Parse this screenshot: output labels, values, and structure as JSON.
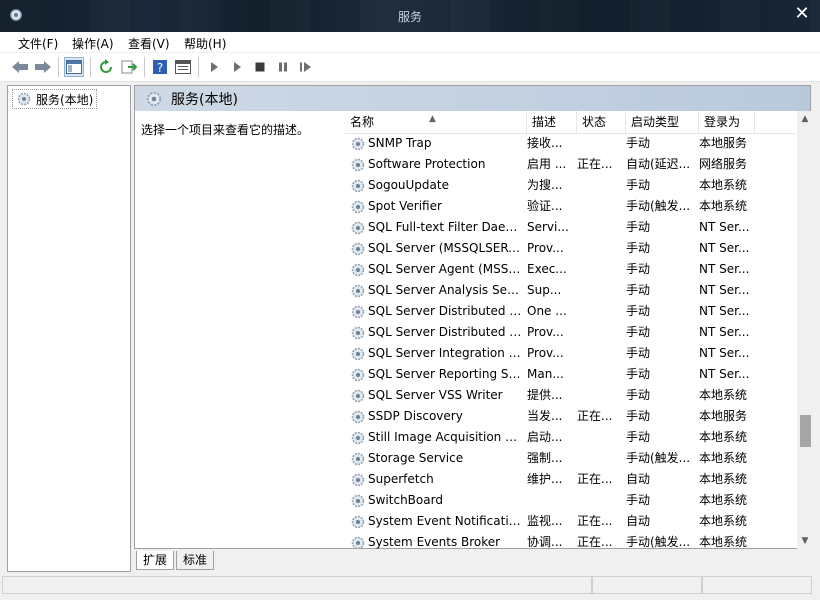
{
  "window": {
    "title": "服务",
    "close": "✕"
  },
  "menu": [
    "文件(F)",
    "操作(A)",
    "查看(V)",
    "帮助(H)"
  ],
  "tree": {
    "root": "服务(本地)"
  },
  "pane": {
    "title": "服务(本地)",
    "description_hint": "选择一个项目来查看它的描述。"
  },
  "columns": [
    "名称",
    "描述",
    "状态",
    "启动类型",
    "登录为"
  ],
  "services": [
    {
      "name": "SNMP Trap",
      "desc": "接收...",
      "status": "",
      "start": "手动",
      "logon": "本地服务"
    },
    {
      "name": "Software Protection",
      "desc": "启用 ...",
      "status": "正在...",
      "start": "自动(延迟...",
      "logon": "网络服务"
    },
    {
      "name": "SogouUpdate",
      "desc": "为搜...",
      "status": "",
      "start": "手动",
      "logon": "本地系统"
    },
    {
      "name": "Spot Verifier",
      "desc": "验证...",
      "status": "",
      "start": "手动(触发...",
      "logon": "本地系统"
    },
    {
      "name": "SQL Full-text Filter Daem...",
      "desc": "Servi...",
      "status": "",
      "start": "手动",
      "logon": "NT Ser..."
    },
    {
      "name": "SQL Server (MSSQLSERV...",
      "desc": "Prov...",
      "status": "",
      "start": "手动",
      "logon": "NT Ser..."
    },
    {
      "name": "SQL Server Agent (MSSQ...",
      "desc": "Exec...",
      "status": "",
      "start": "手动",
      "logon": "NT Ser..."
    },
    {
      "name": "SQL Server Analysis Servi...",
      "desc": "Sup...",
      "status": "",
      "start": "手动",
      "logon": "NT Ser..."
    },
    {
      "name": "SQL Server Distributed R...",
      "desc": "One ...",
      "status": "",
      "start": "手动",
      "logon": "NT Ser..."
    },
    {
      "name": "SQL Server Distributed R...",
      "desc": "Prov...",
      "status": "",
      "start": "手动",
      "logon": "NT Ser..."
    },
    {
      "name": "SQL Server Integration S...",
      "desc": "Prov...",
      "status": "",
      "start": "手动",
      "logon": "NT Ser..."
    },
    {
      "name": "SQL Server Reporting Se...",
      "desc": "Man...",
      "status": "",
      "start": "手动",
      "logon": "NT Ser..."
    },
    {
      "name": "SQL Server VSS Writer",
      "desc": "提供...",
      "status": "",
      "start": "手动",
      "logon": "本地系统"
    },
    {
      "name": "SSDP Discovery",
      "desc": "当发...",
      "status": "正在...",
      "start": "手动",
      "logon": "本地服务"
    },
    {
      "name": "Still Image Acquisition Ev...",
      "desc": "启动...",
      "status": "",
      "start": "手动",
      "logon": "本地系统"
    },
    {
      "name": "Storage Service",
      "desc": "强制...",
      "status": "",
      "start": "手动(触发...",
      "logon": "本地系统"
    },
    {
      "name": "Superfetch",
      "desc": "维护...",
      "status": "正在...",
      "start": "自动",
      "logon": "本地系统"
    },
    {
      "name": "SwitchBoard",
      "desc": "",
      "status": "",
      "start": "手动",
      "logon": "本地系统"
    },
    {
      "name": "System Event Notification...",
      "desc": "监视...",
      "status": "正在...",
      "start": "自动",
      "logon": "本地系统"
    },
    {
      "name": "System Events Broker",
      "desc": "协调...",
      "status": "正在...",
      "start": "手动(触发...",
      "logon": "本地系统"
    }
  ],
  "tabs": [
    "扩展",
    "标准"
  ],
  "colors": {
    "accent": "#2f6db5",
    "header_gradient": "#cfd9e6"
  }
}
